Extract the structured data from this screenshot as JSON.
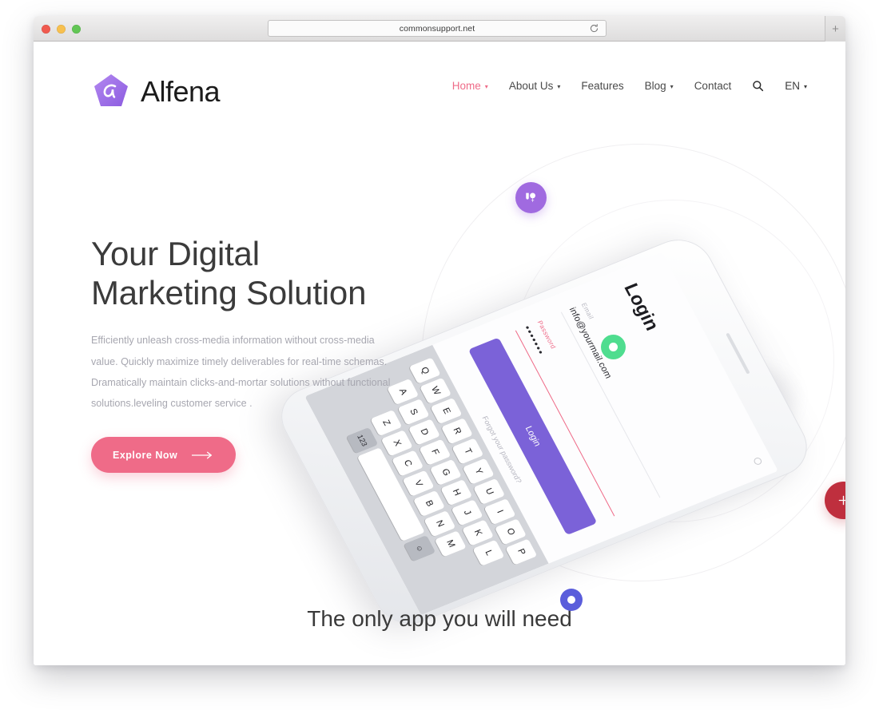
{
  "browser": {
    "url": "commonsupport.net",
    "reload_icon": "reload-icon",
    "new_tab_label": "+",
    "traffic_lights": [
      "close-red",
      "minimize-yellow",
      "zoom-green"
    ]
  },
  "header": {
    "logo": {
      "mark_icon": "alfena-pentagon-logo-icon",
      "wordmark": "Alfena"
    },
    "nav": [
      {
        "label": "Home",
        "has_caret": true,
        "active": true
      },
      {
        "label": "About Us",
        "has_caret": true,
        "active": false
      },
      {
        "label": "Features",
        "has_caret": false,
        "active": false
      },
      {
        "label": "Blog",
        "has_caret": true,
        "active": false
      },
      {
        "label": "Contact",
        "has_caret": false,
        "active": false
      }
    ],
    "search_icon": "search-icon",
    "language": {
      "label": "EN",
      "caret": "▾"
    },
    "caret_glyph": "▾"
  },
  "hero": {
    "title": "Your Digital\nMarketing Solution",
    "paragraph": "Efficiently unleash cross-media information without cross-media value. Quickly maximize timely deliverables for real-time schemas. Dramatically maintain clicks-and-mortar solutions without functional solutions.leveling customer service .",
    "cta_label": "Explore Now",
    "cta_arrow_icon": "arrow-right-icon"
  },
  "badges": [
    {
      "name": "badge-purple",
      "icon": "balloon-icon",
      "color": "#a06ae0"
    },
    {
      "name": "badge-green",
      "icon": "dot-ring-icon",
      "color": "#4fdd8f"
    },
    {
      "name": "badge-cyan",
      "icon": "dot-halo-icon",
      "color": "#2ed2e6"
    },
    {
      "name": "badge-blue",
      "icon": "dot-ring-icon",
      "color": "#5a5ddb"
    },
    {
      "name": "badge-red",
      "icon": "plus-icon",
      "color": "#bf2f3e"
    }
  ],
  "phone": {
    "screen_title": "Login",
    "email_label": "Email",
    "email_value": "info@yourmail.com",
    "password_label": "Password",
    "password_value": "•••••••",
    "login_button": "Login",
    "forgot_link": "Forgot your password?",
    "eye_icon": "eye-icon",
    "keyboard": {
      "row1": [
        "Q",
        "W",
        "E",
        "R",
        "T",
        "Y",
        "U",
        "I",
        "O",
        "P"
      ],
      "row2": [
        "A",
        "S",
        "D",
        "F",
        "G",
        "H",
        "J",
        "K",
        "L"
      ],
      "row3": [
        "Z",
        "X",
        "C",
        "V",
        "B",
        "N",
        "M"
      ],
      "row4": [
        "123",
        "space",
        "☺"
      ],
      "emoji_key": "☺",
      "numeric_key": "123"
    }
  },
  "section": {
    "headline": "The only app you will need"
  },
  "colors": {
    "accent_pink": "#ef6b88",
    "brand_purple": "#a06ae0",
    "phone_button_purple": "#7b62d8",
    "green": "#4fdd8f",
    "cyan": "#2ed2e6",
    "blue": "#5a5ddb",
    "red": "#bf2f3e",
    "text_dark": "#3b3b3b",
    "text_muted": "#a7a7b0"
  }
}
